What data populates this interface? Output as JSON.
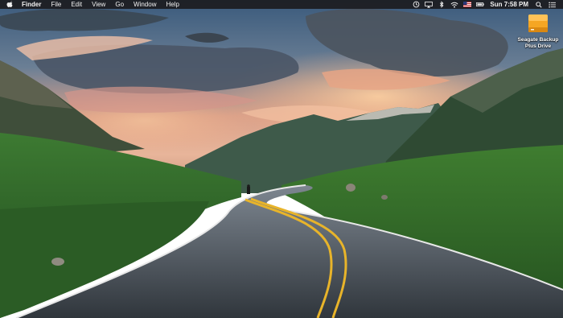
{
  "menubar": {
    "app_name": "Finder",
    "menus": [
      "File",
      "Edit",
      "View",
      "Go",
      "Window",
      "Help"
    ],
    "status_icons": [
      "sync-icon",
      "airplay-icon",
      "bluetooth-icon",
      "wifi-icon",
      "us-flag-icon",
      "battery-icon"
    ],
    "clock": "Sun 7:58 PM"
  },
  "desktop": {
    "drive_label_line1": "Seagate Backup",
    "drive_label_line2": "Plus Drive",
    "drive_color": "#f5a623"
  },
  "colors": {
    "menubar_bg": "#1c1c20",
    "sky_top": "#3d5a7a",
    "grass": "#2f6b2a",
    "road": "#3a4147",
    "center_line": "#e8b42a"
  }
}
